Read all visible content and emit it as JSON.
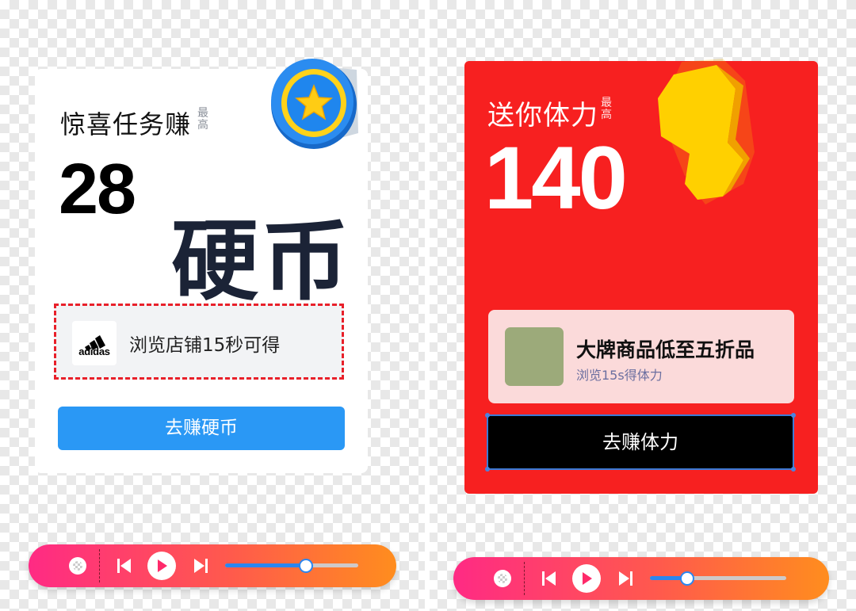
{
  "left_card": {
    "title": "惊喜任务赚",
    "max_label": "最高",
    "amount": "28",
    "unit": "硬币",
    "shop": {
      "brand": "adidas",
      "description": "浏览店铺15秒可得"
    },
    "button_label": "去赚硬币"
  },
  "right_card": {
    "title": "送你体力",
    "max_label": "最高",
    "amount": "140",
    "product": {
      "title": "大牌商品低至五折品",
      "subtitle": "浏览15s得体力"
    },
    "button_label": "去赚体力"
  },
  "players": [
    {
      "progress": 0.6,
      "icons": [
        "disc-icon",
        "previous-icon",
        "play-icon",
        "next-icon"
      ]
    },
    {
      "progress": 0.27,
      "icons": [
        "disc-icon",
        "previous-icon",
        "play-icon",
        "next-icon"
      ]
    }
  ],
  "colors": {
    "primary_blue": "#2a98f5",
    "red_card": "#f72020",
    "dashed_border": "#e8202a",
    "player_gradient_start": "#ff2a84",
    "player_gradient_end": "#ff8d1e"
  }
}
